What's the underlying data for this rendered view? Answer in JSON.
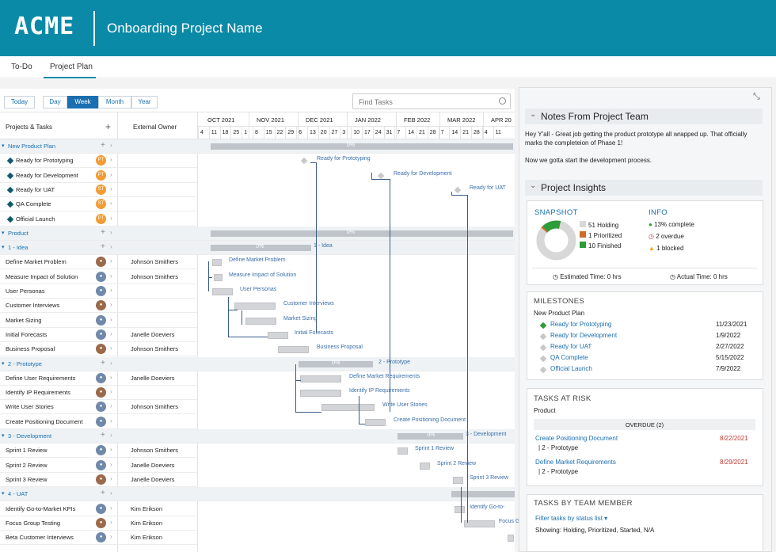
{
  "app": {
    "logo": "ACME",
    "project_title": "Onboarding Project Name"
  },
  "tabs": [
    {
      "label": "To-Do"
    },
    {
      "label": "Project Plan"
    }
  ],
  "toolbar": {
    "today": "Today",
    "views": [
      "Day",
      "Week",
      "Month",
      "Year"
    ],
    "active_view": "Week",
    "search_placeholder": "Find Tasks"
  },
  "columns": {
    "tasks": "Projects & Tasks",
    "owner": "External Owner"
  },
  "timeline": {
    "months": [
      "OCT 2021",
      "NOV 2021",
      "DEC 2021",
      "JAN 2022",
      "FEB 2022",
      "MAR 2022",
      "APR 20"
    ],
    "days": [
      "4",
      "11",
      "18",
      "25",
      "1",
      "8",
      "15",
      "22",
      "29",
      "6",
      "13",
      "20",
      "27",
      "3",
      "10",
      "17",
      "24",
      "31",
      "7",
      "14",
      "21",
      "28",
      "7",
      "14",
      "21",
      "28",
      "4",
      "11"
    ]
  },
  "rows": [
    {
      "name": "New Product Plan",
      "type": "section",
      "owner": ""
    },
    {
      "name": "Ready for Prototyping",
      "type": "milestone",
      "owner": "",
      "avatar": "PT"
    },
    {
      "name": "Ready for Development",
      "type": "milestone",
      "owner": "",
      "avatar": "PT"
    },
    {
      "name": "Ready for UAT",
      "type": "milestone",
      "owner": "",
      "avatar": "ST"
    },
    {
      "name": "QA Complete",
      "type": "milestone",
      "owner": "",
      "avatar": "ST"
    },
    {
      "name": "Official Launch",
      "type": "milestone",
      "owner": "",
      "avatar": "PT"
    },
    {
      "name": "Product",
      "type": "section",
      "owner": ""
    },
    {
      "name": "1 - Idea",
      "type": "phase",
      "owner": ""
    },
    {
      "name": "Define Market Problem",
      "type": "task",
      "owner": "Johnson Smithers"
    },
    {
      "name": "Measure Impact of Solution",
      "type": "task",
      "owner": "Johnson Smithers"
    },
    {
      "name": "User Personas",
      "type": "task",
      "owner": ""
    },
    {
      "name": "Customer Interviews",
      "type": "task",
      "owner": ""
    },
    {
      "name": "Market Sizing",
      "type": "task",
      "owner": ""
    },
    {
      "name": "Initial Forecasts",
      "type": "task",
      "owner": "Janelle Doeviers"
    },
    {
      "name": "Business Proposal",
      "type": "task",
      "owner": "Johnson Smithers"
    },
    {
      "name": "2 - Prototype",
      "type": "phase",
      "owner": ""
    },
    {
      "name": "Define User Requirements",
      "type": "task",
      "owner": "Janelle Doeviers"
    },
    {
      "name": "Identify IP Requirements",
      "type": "task",
      "owner": ""
    },
    {
      "name": "Write User Stories",
      "type": "task",
      "owner": "Johnson Smithers"
    },
    {
      "name": "Create Positioning Document",
      "type": "task",
      "owner": ""
    },
    {
      "name": "3 - Development",
      "type": "phase",
      "owner": ""
    },
    {
      "name": "Sprint 1 Review",
      "type": "task",
      "owner": "Johnson Smithers"
    },
    {
      "name": "Sprint 2 Review",
      "type": "task",
      "owner": "Janelle Doeviers"
    },
    {
      "name": "Sprint 3 Review",
      "type": "task",
      "owner": "Janelle Doeviers"
    },
    {
      "name": "4 - UAT",
      "type": "phase",
      "owner": ""
    },
    {
      "name": "Identify Go-to-Market KPIs",
      "type": "task",
      "owner": "Kim Erikson"
    },
    {
      "name": "Focus Group Testing",
      "type": "task",
      "owner": "Kim Erikson"
    },
    {
      "name": "Beta Customer Interviews",
      "type": "task",
      "owner": "Kim Erikson"
    }
  ],
  "gantt_labels": {
    "r1": "Ready for Prototyping",
    "r2": "Ready for Development",
    "r3": "Ready for UAT",
    "idea": "1 - Idea",
    "t8": "Define Market Problem",
    "t9": "Measure Impact of Solution",
    "t10": "User Personas",
    "t11": "Customer Interviews",
    "t12": "Market Sizing",
    "t13": "Initial Forecasts",
    "t14": "Business Proposal",
    "proto": "2 - Prototype",
    "t16": "Define Market Requirements",
    "t17": "Identify IP Requirements",
    "t18": "Write User Stories",
    "t19": "Create Positioning Document",
    "dev": "3 - Development",
    "t21": "Sprint 1 Review",
    "t22": "Sprint 2 Review",
    "t23": "Sprint 3 Review",
    "t25": "Identify Go-to-",
    "t26": "Focus Gro",
    "pct": "0%"
  },
  "notes": {
    "title": "Notes From Project Team",
    "text1": "Hey Y'all - Great job getting the product prototype all wrapped up. That officially marks the completeion of Phase 1!",
    "text2": "Now we gotta start the development process."
  },
  "insights": {
    "title": "Project Insights",
    "snapshot": "SNAPSHOT",
    "info": "INFO",
    "legend": [
      "51 Holding",
      "1 Prioritized",
      "10 Finished"
    ],
    "info_items": [
      "13% complete",
      "2 overdue",
      "1 blocked"
    ],
    "estimated": "Estimated Time: 0 hrs",
    "actual": "Actual Time: 0 hrs",
    "colors": {
      "holding": "#d8d8d8",
      "prioritized": "#d26a2a",
      "finished": "#2d9d3a"
    }
  },
  "milestones": {
    "title": "MILESTONES",
    "plan": "New Product Plan",
    "items": [
      {
        "name": "Ready for Prototyping",
        "date": "11/23/2021"
      },
      {
        "name": "Ready for Development",
        "date": "1/9/2022"
      },
      {
        "name": "Ready for UAT",
        "date": "2/27/2022"
      },
      {
        "name": "QA Complete",
        "date": "5/15/2022"
      },
      {
        "name": "Official Launch",
        "date": "7/9/2022"
      }
    ]
  },
  "risk": {
    "title": "TASKS AT RISK",
    "group": "Product",
    "overdue": "OVERDUE (2)",
    "items": [
      {
        "name": "Create Positioning Document",
        "sub": "| 2 - Prototype",
        "date": "8/22/2021"
      },
      {
        "name": "Define Market Requirements",
        "sub": "| 2 - Prototype",
        "date": "8/29/2021"
      }
    ]
  },
  "team": {
    "title": "TASKS BY TEAM MEMBER",
    "filter": "Filter tasks by status list",
    "showing": "Showing: Holding, Prioritized, Started, N/A"
  }
}
